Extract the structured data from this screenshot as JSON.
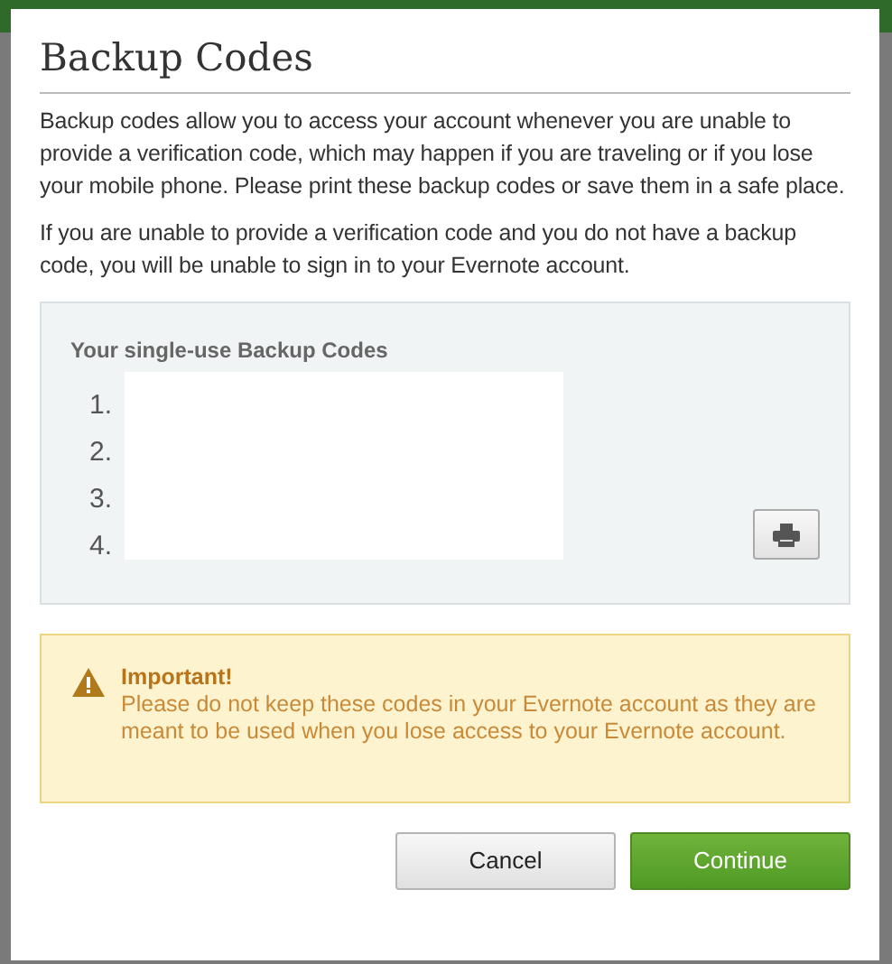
{
  "dialog": {
    "title": "Backup Codes",
    "paragraphs": [
      "Backup codes allow you to access your account whenever you are unable to provide a verification code, which may happen if you are traveling or if you lose your mobile phone. Please print these backup codes or save them in a safe place.",
      "If you are unable to provide a verification code and you do not have a backup code, you will be unable to sign in to your Evernote account."
    ],
    "codes_panel": {
      "heading": "Your single-use Backup Codes",
      "numbers": [
        "1.",
        "2.",
        "3.",
        "4."
      ]
    },
    "warning": {
      "title": "Important!",
      "text": "Please do not keep these codes in your Evernote account as they are meant to be used when you lose access to your Evernote account."
    },
    "buttons": [
      {
        "label": "Cancel",
        "kind": "secondary"
      },
      {
        "label": "Continue",
        "kind": "primary"
      }
    ]
  }
}
